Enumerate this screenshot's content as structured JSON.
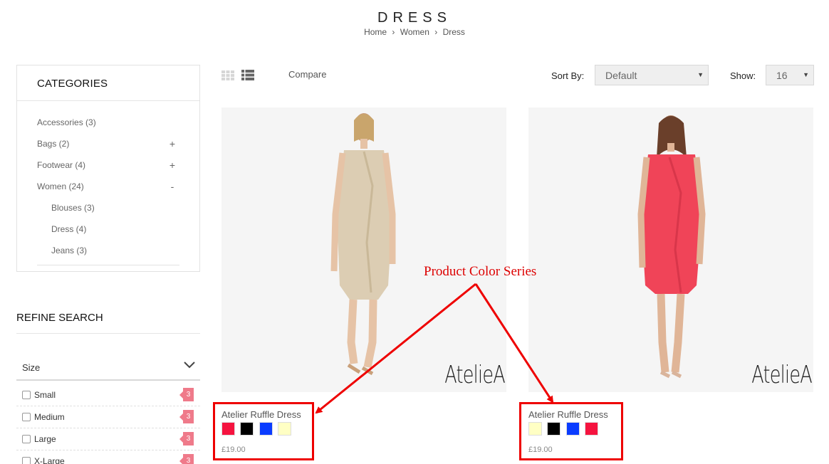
{
  "header": {
    "title": "DRESS",
    "breadcrumb": [
      "Home",
      "Women",
      "Dress"
    ],
    "separator": "›"
  },
  "sidebar": {
    "categories_title": "CATEGORIES",
    "categories": [
      {
        "label": "Accessories (3)",
        "toggle": ""
      },
      {
        "label": "Bags (2)",
        "toggle": "+"
      },
      {
        "label": "Footwear (4)",
        "toggle": "+"
      },
      {
        "label": "Women (24)",
        "toggle": "-"
      },
      {
        "label": "Blouses (3)",
        "toggle": ""
      },
      {
        "label": "Dress (4)",
        "toggle": ""
      },
      {
        "label": "Jeans (3)",
        "toggle": ""
      }
    ],
    "refine_title": "REFINE SEARCH",
    "size_filter": {
      "label": "Size",
      "options": [
        {
          "label": "Small",
          "count": "3"
        },
        {
          "label": "Medium",
          "count": "3"
        },
        {
          "label": "Large",
          "count": "3"
        },
        {
          "label": "X-Large",
          "count": "3"
        }
      ]
    }
  },
  "toolbar": {
    "compare_label": "Compare",
    "sort_label": "Sort By:",
    "sort_value": "Default",
    "show_label": "Show:",
    "show_value": "16"
  },
  "products": [
    {
      "name": "Atelier Ruffle Dress",
      "price": "£19.00",
      "brand": "AtelieA",
      "dress_color": "#dccdb3",
      "swatches": [
        "#f5133f",
        "#000000",
        "#0a3cff",
        "#ffffc4"
      ]
    },
    {
      "name": "Atelier Ruffle Dress",
      "price": "£19.00",
      "brand": "AtelieA",
      "dress_color": "#f04458",
      "swatches": [
        "#ffffc4",
        "#000000",
        "#0a3cff",
        "#f5133f"
      ]
    }
  ],
  "annotation": {
    "text": "Product Color Series",
    "color": "#dd0000"
  }
}
